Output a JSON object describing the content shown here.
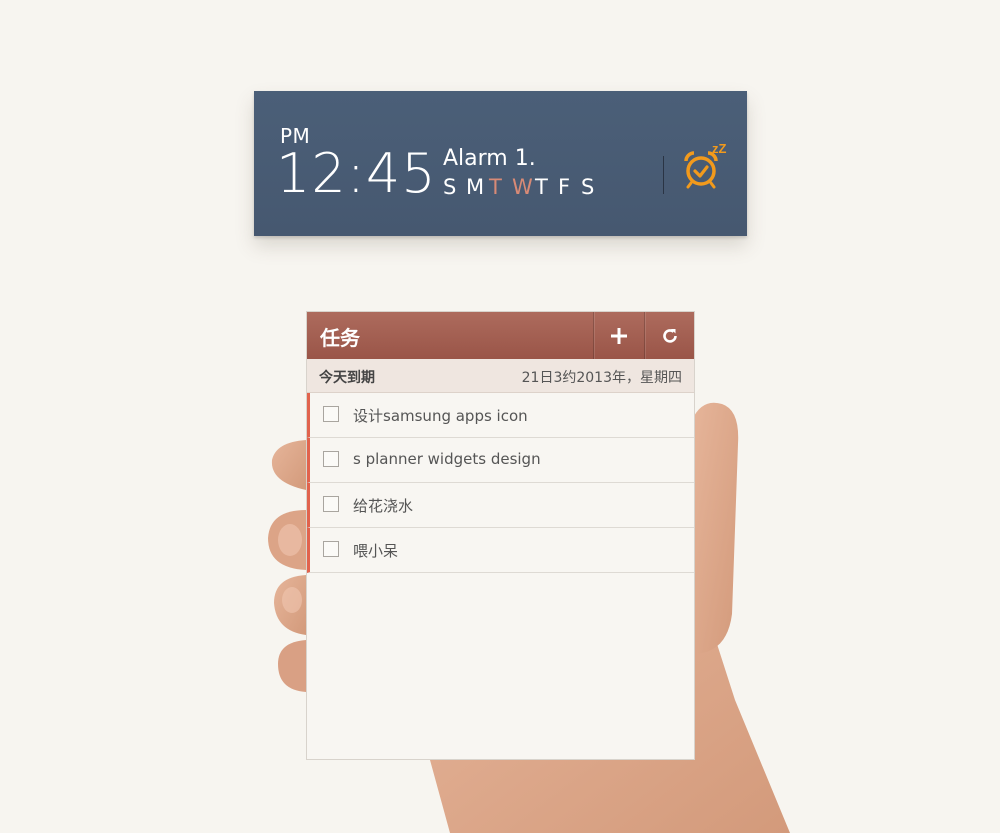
{
  "alarm_widget": {
    "ampm": "PM",
    "time": "12:45",
    "alarm_name": "Alarm 1.",
    "days": [
      {
        "letter": "S",
        "active": false
      },
      {
        "letter": "M",
        "active": false
      },
      {
        "letter": "T",
        "active": true
      },
      {
        "letter": "W",
        "active": true
      },
      {
        "letter": "T",
        "active": false
      },
      {
        "letter": "F",
        "active": false
      },
      {
        "letter": "S",
        "active": false
      }
    ],
    "snooze_text": "zZ",
    "icon": "alarm-clock-icon",
    "colors": {
      "background": "#4b5f78",
      "active_day": "#d88a76",
      "icon": "#f29a1c"
    }
  },
  "tasks_widget": {
    "title": "任务",
    "add_icon": "plus-icon",
    "refresh_icon": "refresh-icon",
    "due_label": "今天到期",
    "date_text": "21日3约2013年，星期四",
    "items": [
      {
        "label": "设计samsung apps icon",
        "checked": false
      },
      {
        "label": "s planner widgets design",
        "checked": false
      },
      {
        "label": "给花浇水",
        "checked": false
      },
      {
        "label": "喂小呆",
        "checked": false
      }
    ],
    "colors": {
      "header": "#a5604f",
      "priority_bar": "#e1634d"
    }
  }
}
